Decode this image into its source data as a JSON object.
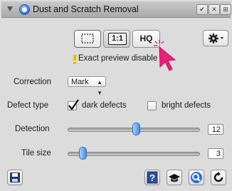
{
  "window": {
    "title": "Dust and Scratch Removal",
    "titlebar_buttons": [
      "✔",
      "✕",
      "⊞"
    ]
  },
  "preview": {
    "buttons": [
      {
        "label": "",
        "icon": "frame-icon"
      },
      {
        "label": "1:1"
      },
      {
        "label": "HQ"
      }
    ],
    "warning": "Exact preview disable",
    "gear_icon": "gear-icon"
  },
  "correction": {
    "label": "Correction",
    "value": "Mark"
  },
  "defect_type": {
    "label": "Defect type",
    "dark": {
      "label": "dark defects",
      "checked": true
    },
    "bright": {
      "label": "bright defects",
      "checked": false
    }
  },
  "detection": {
    "label": "Detection",
    "value": "12",
    "level": 0.52
  },
  "tile_size": {
    "label": "Tile size",
    "value": "3",
    "level": 0.09
  },
  "footer": {
    "icons": [
      "save-icon",
      "help-icon",
      "graduation-cap-icon",
      "zoom-icon",
      "reset-icon"
    ]
  },
  "colors": {
    "accent": "#e8207a",
    "thumb": "#4a8de0"
  }
}
